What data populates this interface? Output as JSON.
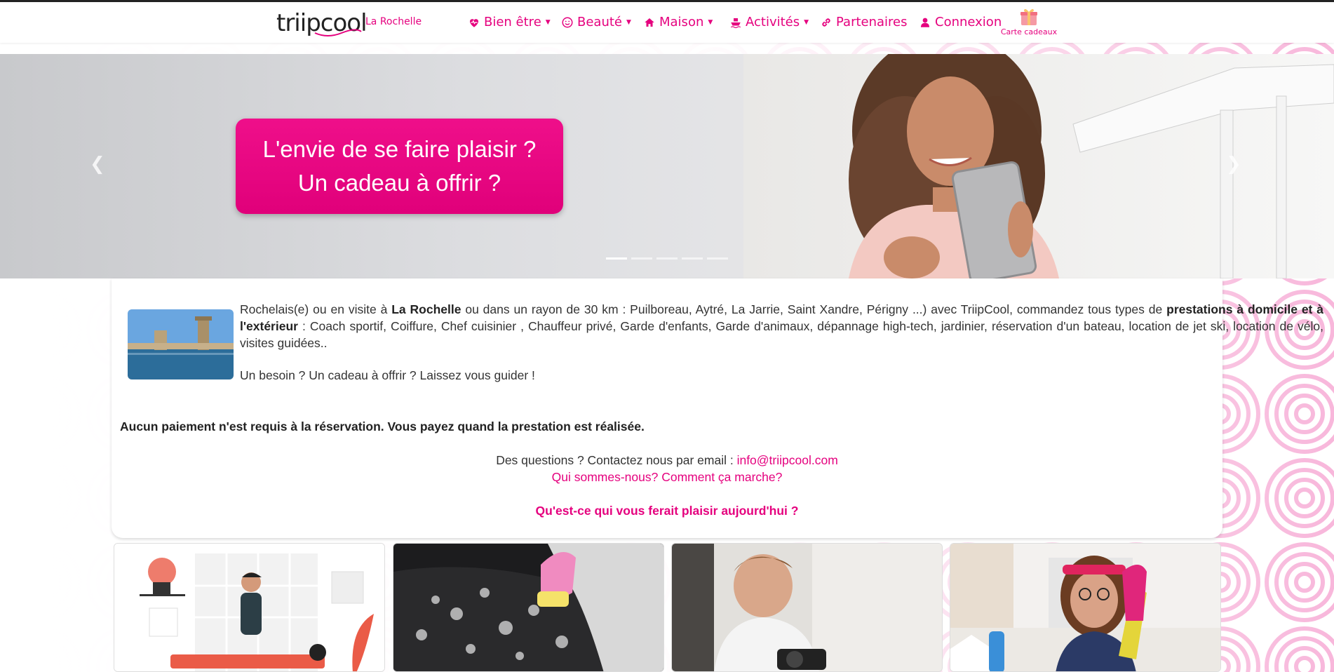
{
  "brand": {
    "logo_text": "triipcool",
    "city": "La Rochelle"
  },
  "nav": {
    "items": [
      {
        "label": "Bien être",
        "icon": "heart-icon",
        "dropdown": true
      },
      {
        "label": "Beauté",
        "icon": "smile-icon",
        "dropdown": true
      },
      {
        "label": "Maison",
        "icon": "home-icon",
        "dropdown": true
      },
      {
        "label": "Activités",
        "icon": "ship-icon",
        "dropdown": true
      },
      {
        "label": "Partenaires",
        "icon": "link-icon",
        "dropdown": false
      },
      {
        "label": "Connexion",
        "icon": "user-icon",
        "dropdown": false
      }
    ],
    "gift_label": "Carte cadeaux"
  },
  "hero": {
    "line1": "L'envie de se faire plaisir ?",
    "line2": "Un cadeau à offrir ?",
    "slides": 5,
    "active_slide": 1
  },
  "intro": {
    "p1_a": "Rochelais(e) ou en visite à ",
    "p1_city": "La Rochelle",
    "p1_b": " ou dans un rayon de 30 km : Puilboreau, Aytré, La Jarrie, Saint Xandre, Périgny ...) avec TriipCool, commandez tous types de ",
    "p1_bold": "prestations à domicile et à l'extérieur",
    "p1_c": " : Coach sportif, Coiffure, Chef cuisinier , Chauffeur privé, Garde d'enfants, Garde d'animaux, dépannage high-tech, jardinier, réservation d'un bateau, location de jet ski, location de vélo, visites guidées..",
    "p2": "Un besoin ? Un cadeau à offrir ? Laissez vous guider !"
  },
  "payment_note": "Aucun paiement n'est requis à la réservation. Vous payez quand la prestation est réalisée.",
  "contact": {
    "prefix": "Des questions ? Contactez nous par email : ",
    "email": "info@triipcool.com",
    "about_link": "Qui sommes-nous? Comment ça marche?",
    "question": "Qu'est-ce qui vous ferait plaisir aujourd'hui ?"
  },
  "colors": {
    "accent": "#e5007e"
  }
}
